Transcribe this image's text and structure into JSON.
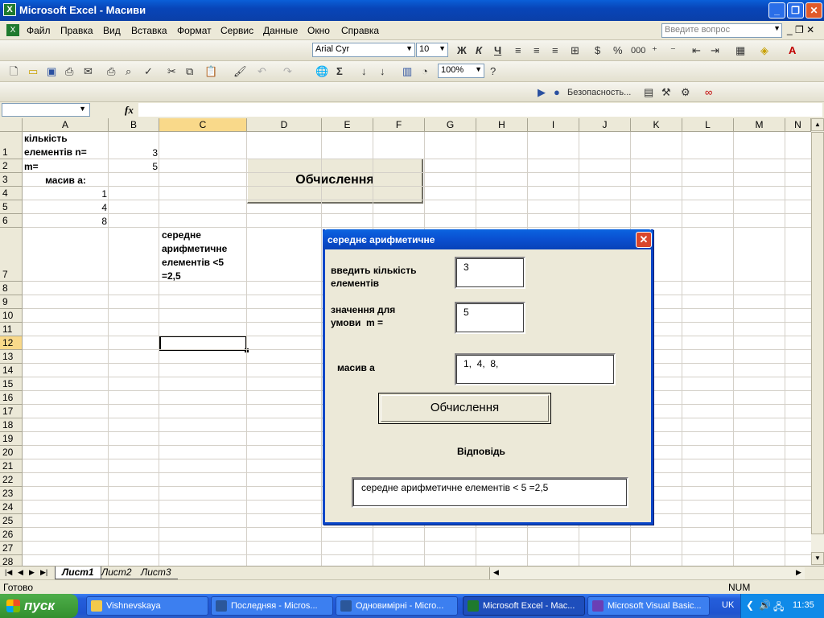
{
  "window": {
    "title": "Microsoft Excel - Масиви",
    "app_icon": "excel-icon",
    "min": "_",
    "max": "❐",
    "close": "✕"
  },
  "menu": {
    "items": [
      "Файл",
      "Правка",
      "Вид",
      "Вставка",
      "Формат",
      "Сервис",
      "Данные",
      "Окно",
      "Справка"
    ],
    "help_placeholder": "Введите вопрос",
    "mdi_buttons": "_ ❐ ✕"
  },
  "toolbar": {
    "font": "Arial Cyr",
    "font_size": "10",
    "bold": "Ж",
    "italic": "К",
    "underline": "Ч",
    "zoom": "100%",
    "security": "Безопасность...",
    "sum": "Σ",
    "percent": "%",
    "thousands": "000"
  },
  "formula_bar": {
    "fx": "fx",
    "name_box": "",
    "formula": ""
  },
  "columns": [
    "A",
    "B",
    "C",
    "D",
    "E",
    "F",
    "G",
    "H",
    "I",
    "J",
    "K",
    "L",
    "M",
    "N"
  ],
  "rows": [
    "1",
    "2",
    "3",
    "4",
    "5",
    "6",
    "7",
    "8",
    "9",
    "10",
    "11",
    "12",
    "13",
    "14",
    "15",
    "16",
    "17",
    "18",
    "19",
    "20",
    "21",
    "22",
    "23",
    "24",
    "25",
    "26",
    "27",
    "28"
  ],
  "cells": {
    "A1": "кількість\nелементів n=",
    "B1": "3",
    "A2": "m=",
    "B2": "5",
    "A3": "масив а:",
    "A4": "1",
    "A5": "4",
    "A6": "8",
    "C7": "середне\nарифметичне\nелементів <5\n=2,5"
  },
  "sheet_button": "Обчислення",
  "dialog": {
    "title": "середнє арифметичне",
    "close": "✕",
    "label_count": "введить кількість\nелементів",
    "value_count": "3",
    "label_condition": "значення для\nумови  m =",
    "value_condition": "5",
    "label_array": "масив а",
    "value_array": "1,  4,  8,",
    "button": "Обчислення",
    "answer_label": "Відповідь",
    "answer_value": "середне арифметичне елементів <  5  =2,5"
  },
  "sheets": {
    "tabs": [
      "Лист1",
      "Лист2",
      "Лист3"
    ],
    "active": "Лист1"
  },
  "status": {
    "left": "Готово",
    "num": "NUM"
  },
  "taskbar": {
    "start": "пуск",
    "tasks": [
      {
        "label": "Vishnevskaya",
        "icon_color": "#f2c94c"
      },
      {
        "label": "Последняя - Micros...",
        "icon_color": "#2b579a"
      },
      {
        "label": "Одновимірні - Micro...",
        "icon_color": "#2b579a"
      },
      {
        "label": "Microsoft Excel - Мас...",
        "icon_color": "#1f7a2e"
      },
      {
        "label": "Microsoft Visual Basic...",
        "icon_color": "#6a3fb5"
      }
    ],
    "active_task": "Microsoft Excel - Мас...",
    "lang": "UK",
    "time": "11:35"
  }
}
